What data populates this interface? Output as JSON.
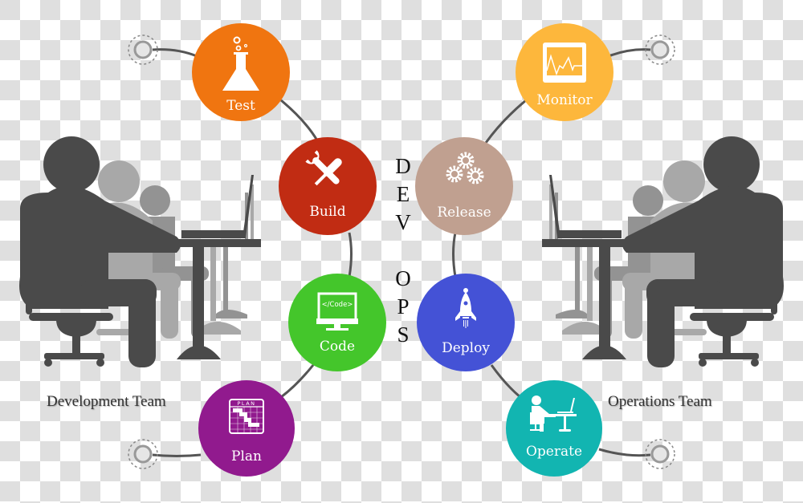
{
  "diagram": {
    "title_letters_dev": [
      "D",
      "E",
      "V"
    ],
    "title_letters_ops": [
      "O",
      "P",
      "S"
    ],
    "teams": {
      "development": "Development Team",
      "operations": "Operations Team"
    },
    "stages": [
      {
        "id": "test",
        "label": "Test",
        "icon": "flask-icon",
        "color": "#f07510",
        "side": "development"
      },
      {
        "id": "build",
        "label": "Build",
        "icon": "wrench-screwdriver-icon",
        "color": "#c12c13",
        "side": "development"
      },
      {
        "id": "code",
        "label": "Code",
        "icon": "code-monitor-icon",
        "color": "#44c62b",
        "side": "development"
      },
      {
        "id": "plan",
        "label": "Plan",
        "icon": "plan-grid-icon",
        "color": "#911a8e",
        "side": "development"
      },
      {
        "id": "monitor",
        "label": "Monitor",
        "icon": "heartbeat-monitor-icon",
        "color": "#fdb73c",
        "side": "operations"
      },
      {
        "id": "release",
        "label": "Release",
        "icon": "gears-icon",
        "color": "#c0a090",
        "side": "operations"
      },
      {
        "id": "deploy",
        "label": "Deploy",
        "icon": "rocket-icon",
        "color": "#4452d6",
        "side": "operations"
      },
      {
        "id": "operate",
        "label": "Operate",
        "icon": "person-at-desk-icon",
        "color": "#12b5b1",
        "side": "operations"
      }
    ],
    "code_icon_text": "</Code>",
    "plan_icon_text": "PLAN",
    "connector_color": "#555555",
    "silhouette_colors": {
      "front": "#4a4a4a",
      "middle": "#a6a6a6",
      "back": "#939393"
    }
  }
}
